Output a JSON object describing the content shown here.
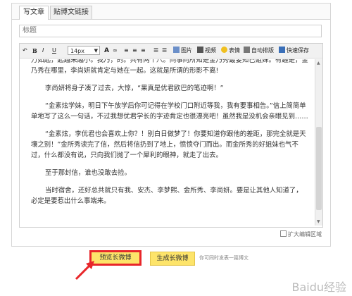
{
  "tabs": [
    {
      "label": "写文章"
    },
    {
      "label": "贴博文链接"
    }
  ],
  "title_input": {
    "placeholder": "标题"
  },
  "toolbar": {
    "bold": "B",
    "italic": "I",
    "underline": "U",
    "font_size": "14px",
    "image_label": "图片",
    "video_label": "视频",
    "emoji_label": "表情",
    "autoformat_label": "自动排版",
    "quicksave_label": "快速保存"
  },
  "content": {
    "paragraphs": [
      "万如起，起越来越小。我乃，的。共有两个八。同事向所知是金乃秀最要知己姐妹。有趣是，金乃秀在哪里，李尚妍就肯定与她在一起。这就是所谓的形影不离!",
      "李尚妍将身子凑了过去，大惊，“果真是优君欧巴的笔迹啊！”",
      "“金素炫学妹，明日下午放学后你可记得在学校门口附近等我，我有要事相告。”信上简简单单地写了这么一句话，不过我想优君学长的字迹肯定也很漂亮吧！虽然我是没机会亲眼见到……",
      "“金素炫，李优君也会喜欢上你？！别白日做梦了！你要知道你跟他的差距，那完全就是天壤之别！”金所秀读完了信，然后将信扔到了地上，愤愤夺门而出。而金所秀的好姐妹也气不过，什么都没有说，只向我们抛了一个犀利的眼神，就走了出去。",
      "至于那封信，谁也没敢去捡。",
      "当时宿舍，还好总共就只有我、安杰、李梦熙、金所秀、李尚妍。要是让其他人知道了，必定是要惹出什么事端来。"
    ]
  },
  "expand_label": "扩大编辑区域",
  "buttons": {
    "preview": "预览长微博",
    "generate": "生成长微博"
  },
  "hint": "你可同时发表一篇博文",
  "watermark": "Baidu经验"
}
